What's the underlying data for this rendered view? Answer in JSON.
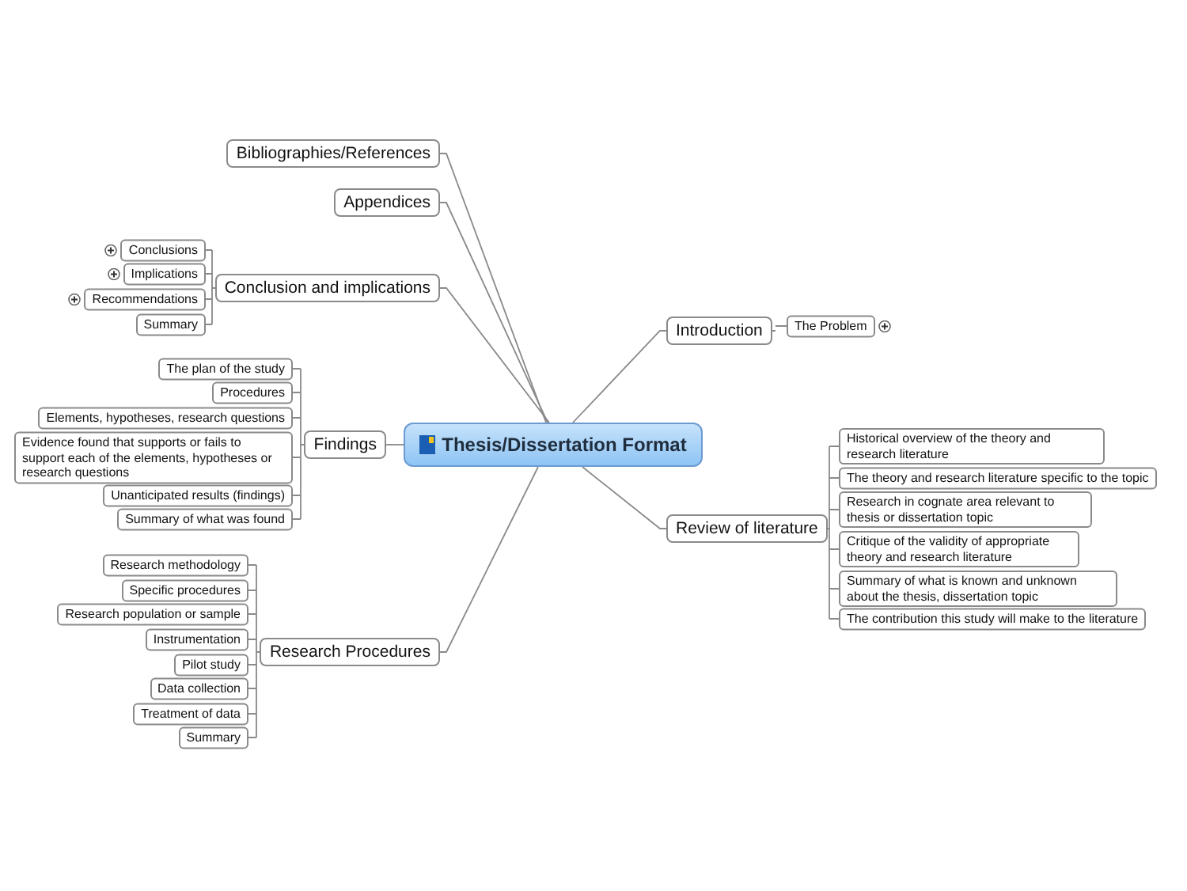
{
  "root": {
    "title": "Thesis/Dissertation Format"
  },
  "branches": [
    {
      "label": "Bibliographies/References"
    },
    {
      "label": "Appendices"
    },
    {
      "label": "Conclusion and implications",
      "children": [
        {
          "label": "Conclusions",
          "collapsed": true
        },
        {
          "label": "Implications",
          "collapsed": true
        },
        {
          "label": "Recommendations",
          "collapsed": true
        },
        {
          "label": "Summary",
          "collapsed": false
        }
      ]
    },
    {
      "label": "Introduction",
      "children": [
        {
          "label": "The Problem",
          "collapsed": true
        }
      ]
    },
    {
      "label": "Findings",
      "children": [
        {
          "label": "The plan of the study",
          "collapsed": false
        },
        {
          "label": "Procedures",
          "collapsed": false
        },
        {
          "label": "Elements, hypotheses, research questions",
          "collapsed": false
        },
        {
          "label": "Evidence found that supports or fails to support each of the elements, hypotheses or research questions",
          "collapsed": false
        },
        {
          "label": "Unanticipated results (findings)",
          "collapsed": false
        },
        {
          "label": "Summary of what was found",
          "collapsed": false
        }
      ]
    },
    {
      "label": "Review of literature",
      "children": [
        {
          "label": "Historical overview of the theory and research literature",
          "collapsed": false
        },
        {
          "label": "The theory and research literature specific to the topic",
          "collapsed": false
        },
        {
          "label": "Research in cognate area relevant to thesis or dissertation topic",
          "collapsed": false
        },
        {
          "label": "Critique of the validity of appropriate theory and research literature",
          "collapsed": false
        },
        {
          "label": "Summary of what is known and unknown about the thesis, dissertation topic",
          "collapsed": false
        },
        {
          "label": "The contribution this study will make to the literature",
          "collapsed": false
        }
      ]
    },
    {
      "label": "Research Procedures",
      "children": [
        {
          "label": "Research methodology",
          "collapsed": false
        },
        {
          "label": "Specific procedures",
          "collapsed": false
        },
        {
          "label": "Research population or sample",
          "collapsed": false
        },
        {
          "label": "Instrumentation",
          "collapsed": false
        },
        {
          "label": "Pilot study",
          "collapsed": false
        },
        {
          "label": "Data collection",
          "collapsed": false
        },
        {
          "label": "Treatment of data",
          "collapsed": false
        },
        {
          "label": "Summary",
          "collapsed": false
        }
      ]
    }
  ]
}
